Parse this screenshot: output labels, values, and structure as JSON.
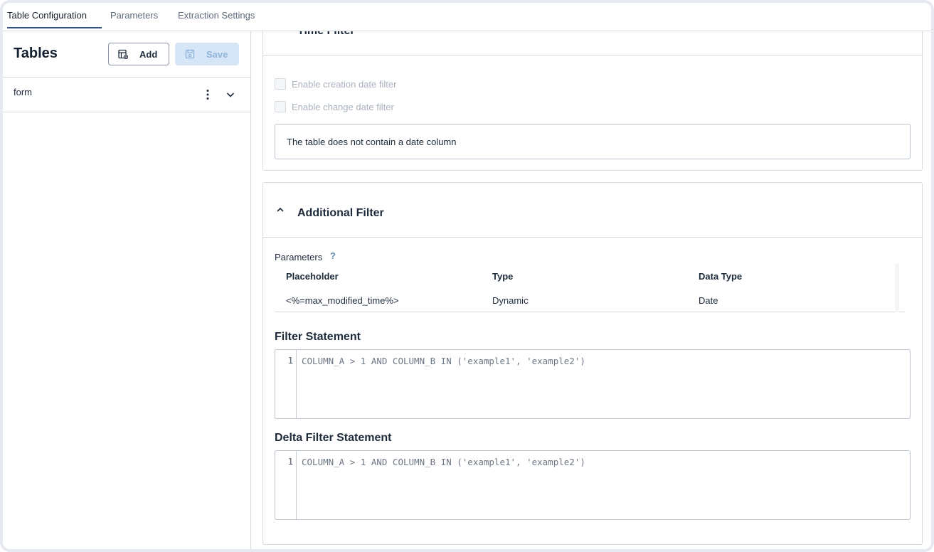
{
  "tabs": [
    {
      "label": "Table Configuration",
      "active": true
    },
    {
      "label": "Parameters",
      "active": false
    },
    {
      "label": "Extraction Settings",
      "active": false
    }
  ],
  "sidebar": {
    "title": "Tables",
    "add_label": "Add",
    "save_label": "Save",
    "items": [
      {
        "label": "form"
      }
    ]
  },
  "time_filter": {
    "title": "Time Filter",
    "creation_label": "Enable creation date filter",
    "change_label": "Enable change date filter",
    "notice": "The table does not contain a date column"
  },
  "additional_filter": {
    "title": "Additional Filter",
    "params_label": "Parameters",
    "help_glyph": "?",
    "columns": [
      "Placeholder",
      "Type",
      "Data Type"
    ],
    "rows": [
      {
        "placeholder": "<%=max_modified_time%>",
        "type": "Dynamic",
        "data_type": "Date"
      }
    ],
    "filter_statement": {
      "title": "Filter Statement",
      "line_number": "1",
      "code": "COLUMN_A > 1 AND COLUMN_B IN ('example1', 'example2')"
    },
    "delta_filter_statement": {
      "title": "Delta Filter Statement",
      "line_number": "1",
      "code": "COLUMN_A > 1 AND COLUMN_B IN ('example1', 'example2')"
    }
  },
  "colors": {
    "accent": "#2f4f7f",
    "border": "#d5dae1",
    "save_bg": "#d6e6f7"
  }
}
